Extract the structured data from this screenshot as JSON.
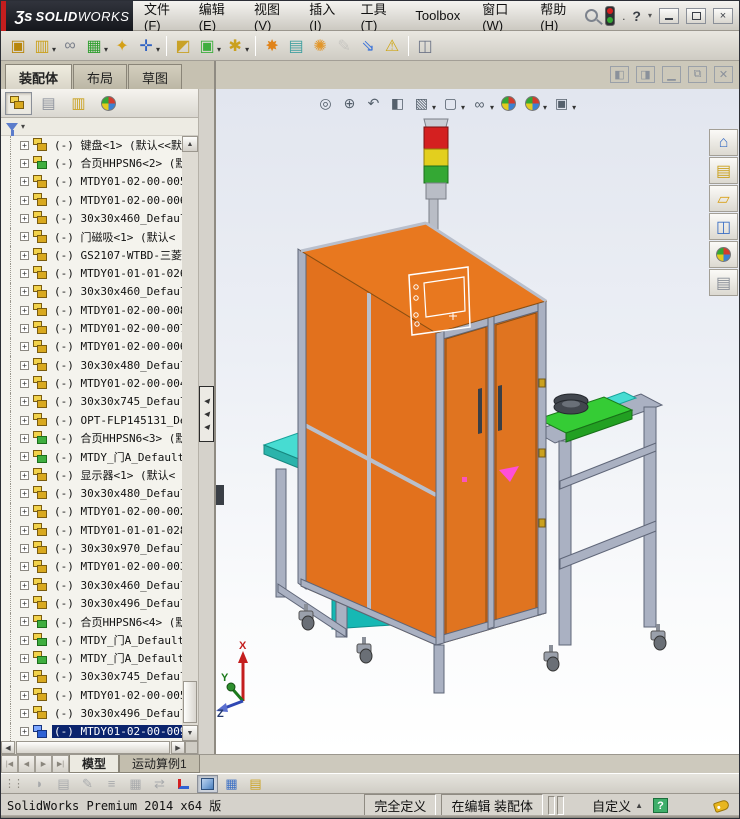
{
  "colors": {
    "accent_red": "#c41e1e",
    "selection": "#0b246d",
    "orange": "#e2711d",
    "orange_top": "#e8781f",
    "orange_dark": "#d8681a",
    "frame": "#aab1c2",
    "frame_dark": "#5f6678",
    "teal": "#16b8b4",
    "green": "#35cc35",
    "cyan": "#47dcd2",
    "ring": "#42474e",
    "tower_red": "#d42020",
    "tower_yellow": "#e3cf1e",
    "tower_green": "#34a834",
    "pole": "#b9bdc6",
    "magenta": "#ff4fd8"
  },
  "titlebar": {
    "logo_prefix": "Ʒs",
    "logo_main": "SOLID",
    "logo_sub": "WORKS",
    "dot": ".",
    "help_label": "?"
  },
  "menubar": {
    "items": [
      "文件(F)",
      "编辑(E)",
      "视图(V)",
      "插入(I)",
      "工具(T)",
      "Toolbox",
      "窗口(W)",
      "帮助(H)"
    ]
  },
  "toolbar": {
    "icons": [
      {
        "name": "insert-component-icon",
        "glyph": "▣",
        "color": "#b8860b"
      },
      {
        "name": "open-part-icon",
        "glyph": "▥",
        "color": "#caa11f",
        "dropdown": true
      },
      {
        "name": "mate-icon",
        "glyph": "∞",
        "color": "#7a7f8a"
      },
      {
        "name": "linear-component-pattern-icon",
        "glyph": "▦",
        "color": "#2e9e2e",
        "dropdown": true
      },
      {
        "name": "smart-fasteners-icon",
        "glyph": "✦",
        "color": "#d4a017"
      },
      {
        "name": "move-component-icon",
        "glyph": "✛",
        "color": "#2f62c4",
        "dropdown": true
      },
      {
        "separator": true
      },
      {
        "name": "show-hidden-components-icon",
        "glyph": "◩",
        "color": "#c9a227"
      },
      {
        "name": "assembly-features-icon",
        "glyph": "▣",
        "color": "#3fae3f",
        "dropdown": true
      },
      {
        "name": "reference-geometry-icon",
        "glyph": "✱",
        "color": "#caa11f",
        "dropdown": true
      },
      {
        "separator": true
      },
      {
        "name": "new-motion-study-icon",
        "glyph": "✸",
        "color": "#e0831a"
      },
      {
        "name": "bill-of-materials-icon",
        "glyph": "▤",
        "color": "#44a1a1"
      },
      {
        "name": "exploded-view-icon",
        "glyph": "✺",
        "color": "#e2962a"
      },
      {
        "name": "explode-line-sketch-icon",
        "glyph": "✎",
        "color": "#9aa0a8",
        "disabled": true
      },
      {
        "name": "interference-detection-icon",
        "glyph": "⇘",
        "color": "#3f76d8"
      },
      {
        "name": "large-assembly-mode-icon",
        "glyph": "⚠",
        "color": "#cfa718"
      },
      {
        "separator": true
      },
      {
        "name": "assembly-visualization-icon",
        "glyph": "◫",
        "color": "#6f7688"
      }
    ]
  },
  "command_tabs": {
    "items": [
      "装配体",
      "布局",
      "草图"
    ],
    "active_index": 0
  },
  "panel": {
    "icons": [
      "featuremanager-tree-icon",
      "propertymanager-icon",
      "configurationmanager-icon",
      "displaymanager-icon"
    ],
    "overflow_label": "»"
  },
  "tree": {
    "items": [
      {
        "label": "(-) 键盘<1> (默认<<默",
        "icon": "yellow"
      },
      {
        "label": "(-) 合页HHPSN6<2> (默",
        "icon": "green"
      },
      {
        "label": "(-) MTDY01-02-00-005",
        "icon": "yellow"
      },
      {
        "label": "(-) MTDY01-02-00-006",
        "icon": "yellow"
      },
      {
        "label": "(-) 30x30x460_Defaul",
        "icon": "yellow"
      },
      {
        "label": "(-) 门磁吸<1> (默认<",
        "icon": "yellow"
      },
      {
        "label": "(-) GS2107-WTBD-三菱",
        "icon": "yellow"
      },
      {
        "label": "(-) MTDY01-01-01-026",
        "icon": "yellow"
      },
      {
        "label": "(-) 30x30x460_Defaul",
        "icon": "yellow"
      },
      {
        "label": "(-) MTDY01-02-00-008",
        "icon": "yellow"
      },
      {
        "label": "(-) MTDY01-02-00-007",
        "icon": "yellow"
      },
      {
        "label": "(-) MTDY01-02-00-006",
        "icon": "yellow"
      },
      {
        "label": "(-) 30x30x480_Defaul",
        "icon": "yellow"
      },
      {
        "label": "(-) MTDY01-02-00-004",
        "icon": "yellow"
      },
      {
        "label": "(-) 30x30x745_Defaul",
        "icon": "yellow"
      },
      {
        "label": "(-) OPT-FLP145131_De",
        "icon": "yellow"
      },
      {
        "label": "(-) 合页HHPSN6<3> (默",
        "icon": "green"
      },
      {
        "label": "(-) MTDY_门A_Default",
        "icon": "green"
      },
      {
        "label": "(-) 显示器<1> (默认<",
        "icon": "yellow"
      },
      {
        "label": "(-) 30x30x480_Defaul",
        "icon": "yellow"
      },
      {
        "label": "(-) MTDY01-02-00-002",
        "icon": "yellow"
      },
      {
        "label": "(-) MTDY01-01-01-028",
        "icon": "yellow"
      },
      {
        "label": "(-) 30x30x970_Defaul",
        "icon": "yellow"
      },
      {
        "label": "(-) MTDY01-02-00-003",
        "icon": "yellow"
      },
      {
        "label": "(-) 30x30x460_Defaul",
        "icon": "yellow"
      },
      {
        "label": "(-) 30x30x496_Defaul",
        "icon": "yellow"
      },
      {
        "label": "(-) 合页HHPSN6<4> (默",
        "icon": "green"
      },
      {
        "label": "(-) MTDY_门A_Default",
        "icon": "green"
      },
      {
        "label": "(-) MTDY_门A_Default",
        "icon": "green"
      },
      {
        "label": "(-) 30x30x745_Defaul",
        "icon": "yellow"
      },
      {
        "label": "(-) MTDY01-02-00-005",
        "icon": "yellow"
      },
      {
        "label": "(-) 30x30x496_Defaul",
        "icon": "yellow"
      },
      {
        "label": "(-) MTDY01-02-00-009",
        "icon": "blue",
        "selected": true
      }
    ]
  },
  "viewport": {
    "headsup": [
      {
        "name": "zoom-fit-icon",
        "glyph": "◎"
      },
      {
        "name": "zoom-area-icon",
        "glyph": "⊕"
      },
      {
        "name": "previous-view-icon",
        "glyph": "↶"
      },
      {
        "name": "section-view-icon",
        "glyph": "◧"
      },
      {
        "name": "view-orientation-icon",
        "glyph": "▧",
        "dropdown": true
      },
      {
        "name": "display-style-icon",
        "glyph": "▢",
        "dropdown": true
      },
      {
        "name": "hide-show-items-icon",
        "glyph": "∞",
        "dropdown": true
      },
      {
        "name": "edit-appearance-icon",
        "ball": true
      },
      {
        "name": "apply-scene-icon",
        "ball": true,
        "dropdown": true
      },
      {
        "name": "view-settings-icon",
        "glyph": "▣",
        "dropdown": true
      }
    ],
    "window_controls": [
      {
        "name": "pane-left-icon",
        "glyph": "◧"
      },
      {
        "name": "pane-right-icon",
        "glyph": "◨"
      },
      {
        "name": "child-minimize-icon",
        "glyph": "▁"
      },
      {
        "name": "child-restore-icon",
        "glyph": "⧉"
      },
      {
        "name": "child-close-icon",
        "glyph": "✕"
      }
    ],
    "taskpane": [
      {
        "name": "solidworks-resources-icon",
        "glyph": "⌂",
        "color": "#3b6fc4"
      },
      {
        "name": "design-library-icon",
        "glyph": "▤",
        "color": "#caa11f"
      },
      {
        "name": "file-explorer-icon",
        "glyph": "▱",
        "color": "#d9a21b"
      },
      {
        "name": "view-palette-icon",
        "glyph": "◫",
        "color": "#3b6fc4"
      },
      {
        "name": "appearances-scenes-icon",
        "ball": true
      },
      {
        "name": "custom-properties-icon",
        "glyph": "▤",
        "color": "#8a8f98"
      }
    ],
    "triad": {
      "x": "X",
      "y": "Y",
      "z": "Z"
    }
  },
  "bottom": {
    "nav_buttons": [
      "|◀",
      "◀",
      "▶",
      "▶|"
    ],
    "tabs": [
      "模型",
      "运动算例1"
    ],
    "active_index": 0
  },
  "motionbar": {
    "icons": [
      {
        "name": "motion-page-icon",
        "glyph": "◗",
        "disabled": true
      },
      {
        "name": "motion-layers-icon",
        "glyph": "▤",
        "disabled": true
      },
      {
        "name": "motion-rotate-icon",
        "glyph": "✎",
        "disabled": true
      },
      {
        "name": "motion-lines-icon",
        "glyph": "≡",
        "disabled": true
      },
      {
        "name": "motion-grid-icon",
        "glyph": "▦",
        "disabled": true
      },
      {
        "name": "motion-swap-icon",
        "glyph": "⇄",
        "disabled": true
      },
      {
        "name": "triad-toggle-icon",
        "special": "axes"
      },
      {
        "name": "shaded-cube-icon",
        "special": "cube",
        "pressed": true
      },
      {
        "name": "grid-table-icon",
        "glyph": "▦",
        "color": "#3b6fc4"
      },
      {
        "name": "notes-icon",
        "glyph": "▤",
        "color": "#caa11f"
      }
    ]
  },
  "statusbar": {
    "product": "SolidWorks Premium 2014 x64 版",
    "define_state": "完全定义",
    "edit_state": "在编辑 装配体",
    "toolbar_preset": "自定义",
    "help": "?"
  }
}
